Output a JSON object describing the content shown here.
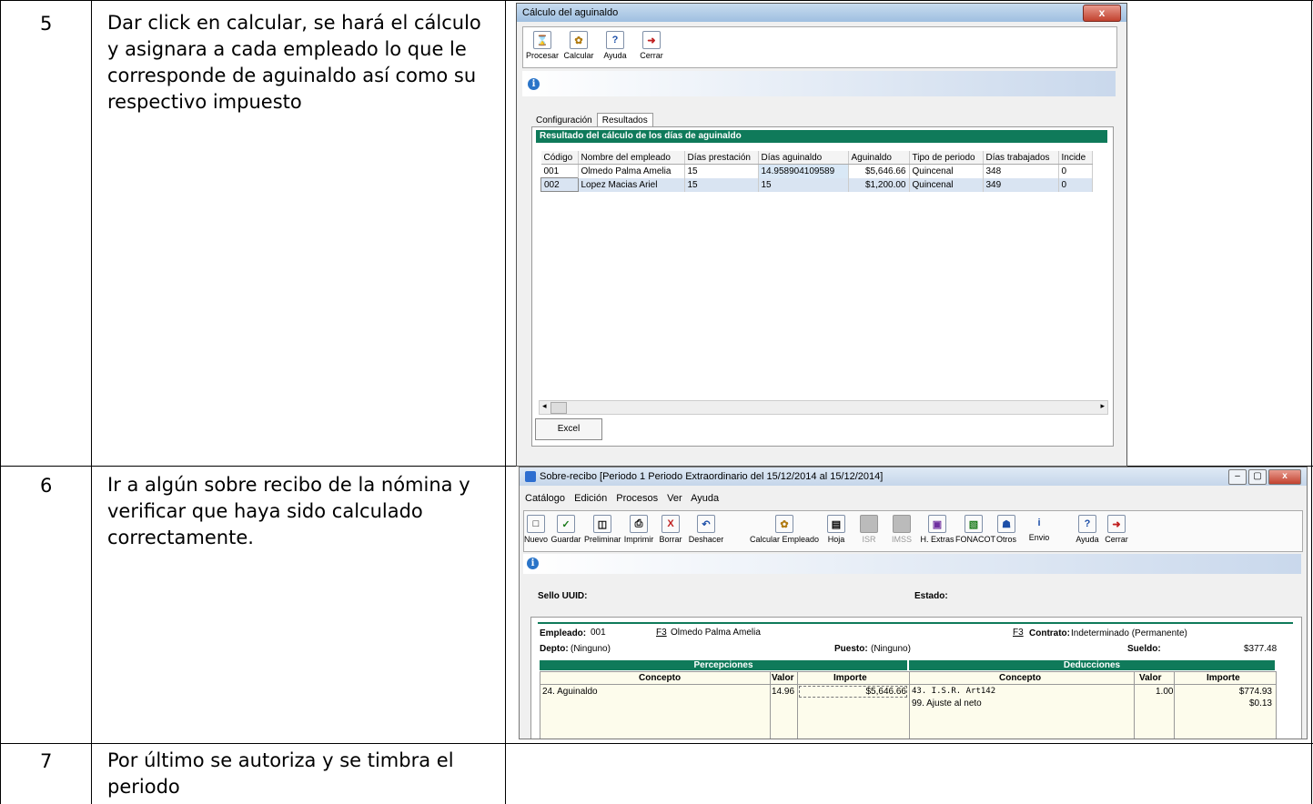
{
  "table": {
    "rows": [
      {
        "num": "5",
        "text": "Dar click en calcular, se hará el cálculo y asignara a cada empleado lo que le corresponde de aguinaldo así como su respectivo impuesto"
      },
      {
        "num": "6",
        "text": "Ir a algún sobre recibo de la nómina y verificar que haya sido calculado correctamente."
      },
      {
        "num": "7",
        "text": "Por último se autoriza y se timbra el periodo"
      }
    ]
  },
  "win1": {
    "title": "Cálculo del aguinaldo",
    "close": "x",
    "toolbar": [
      "Procesar",
      "Calcular",
      "Ayuda",
      "Cerrar"
    ],
    "tabs": [
      "Configuración",
      "Resultados"
    ],
    "section_title": "Resultado del cálculo de los días de aguinaldo",
    "columns": [
      "Código",
      "Nombre del empleado",
      "Días prestación",
      "Días aguinaldo",
      "Aguinaldo",
      "Tipo de periodo",
      "Días trabajados",
      "Incide"
    ],
    "rows": [
      [
        "001",
        "Olmedo Palma Amelia",
        "15",
        "14.958904109589",
        "$5,646.66",
        "Quincenal",
        "348",
        "0"
      ],
      [
        "002",
        "Lopez Macias Ariel",
        "15",
        "15",
        "$1,200.00",
        "Quincenal",
        "349",
        "0"
      ]
    ],
    "excel": "Excel"
  },
  "win2": {
    "title": "Sobre-recibo [Periodo 1 Periodo Extraordinario del 15/12/2014 al 15/12/2014]",
    "menu": [
      "Catálogo",
      "Edición",
      "Procesos",
      "Ver",
      "Ayuda"
    ],
    "toolbar": [
      "Nuevo",
      "Guardar",
      "Preliminar",
      "Imprimir",
      "Borrar",
      "Deshacer",
      "Calcular Empleado",
      "Hoja",
      "ISR",
      "IMSS",
      "H. Extras",
      "FONACOT",
      "Otros",
      "Envio",
      "Ayuda",
      "Cerrar"
    ],
    "sello_label": "Sello UUID:",
    "estado_label": "Estado:",
    "empleado_label": "Empleado:",
    "empleado_code": "001",
    "f3": "F3",
    "empleado_name": "Olmedo Palma Amelia",
    "contrato_label": "Contrato:",
    "contrato_value": "Indeterminado (Permanente)",
    "depto_label": "Depto:",
    "depto_value": "(Ninguno)",
    "puesto_label": "Puesto:",
    "puesto_value": "(Ninguno)",
    "sueldo_label": "Sueldo:",
    "sueldo_value": "$377.48",
    "percepciones": "Percepciones",
    "deducciones": "Deducciones",
    "concepto": "Concepto",
    "valor": "Valor",
    "importe": "Importe",
    "perc_rows": [
      {
        "concepto": "24. Aguinaldo",
        "valor": "14.96",
        "importe": "$5,646.66"
      }
    ],
    "ded_rows": [
      {
        "concepto": "43. I.S.R. Art142",
        "valor": "1.00",
        "importe": "$774.93"
      },
      {
        "concepto": "99. Ajuste al neto",
        "valor": "",
        "importe": "$0.13"
      }
    ]
  }
}
